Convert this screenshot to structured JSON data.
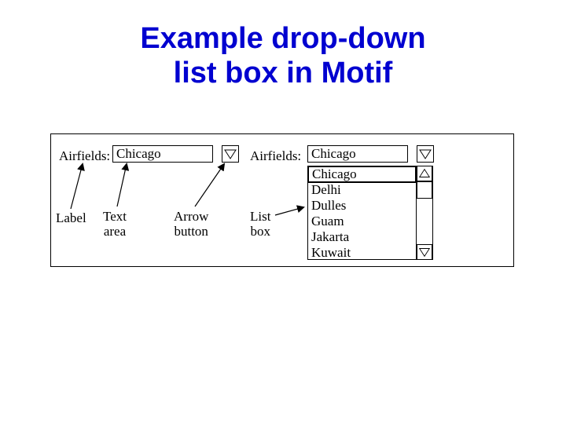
{
  "title_line1": "Example drop-down",
  "title_line2": "list box in Motif",
  "left": {
    "label": "Airfields:",
    "value": "Chicago"
  },
  "right": {
    "label": "Airfields:",
    "value": "Chicago",
    "items": [
      "Chicago",
      "Delhi",
      "Dulles",
      "Guam",
      "Jakarta",
      "Kuwait"
    ],
    "selected_index": 0
  },
  "callouts": {
    "label": "Label",
    "text_area_l1": "Text",
    "text_area_l2": "area",
    "arrow_l1": "Arrow",
    "arrow_l2": "button",
    "listbox_l1": "List",
    "listbox_l2": "box"
  }
}
